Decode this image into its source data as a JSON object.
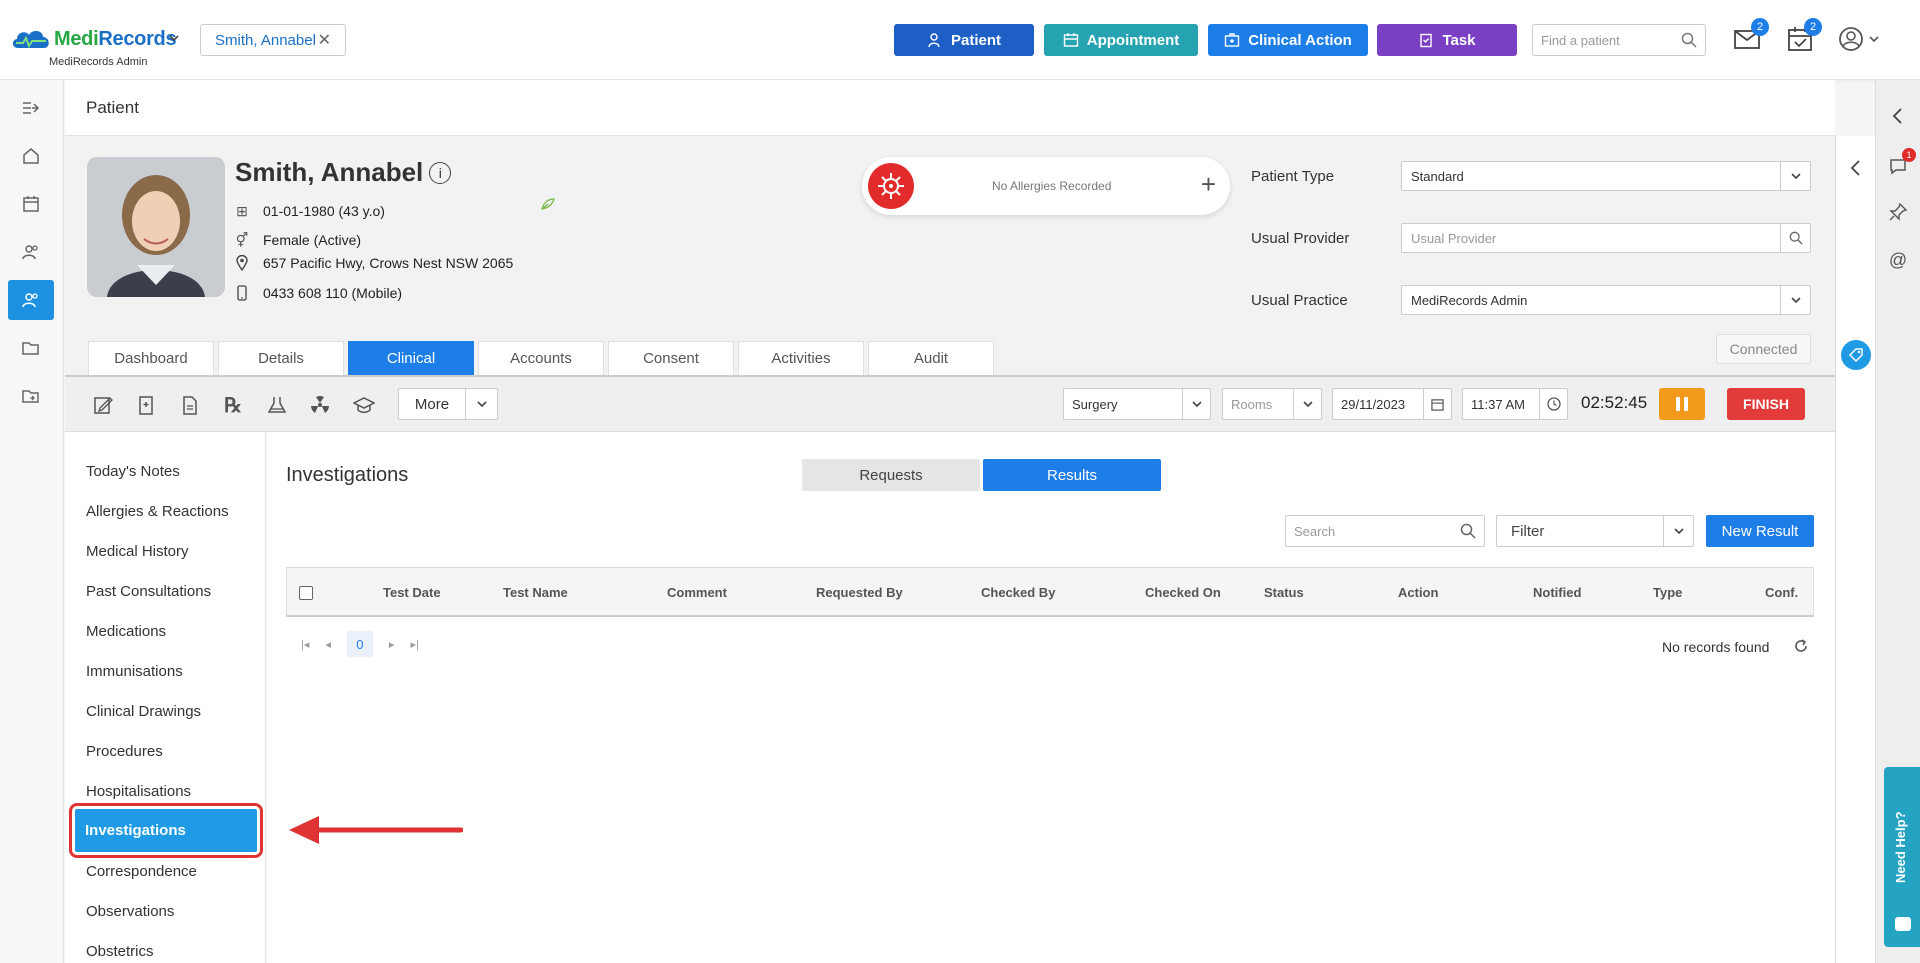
{
  "app": {
    "logo_part1": "Medi",
    "logo_part2": "Records",
    "subtitle": "MediRecords Admin"
  },
  "topbar": {
    "patient_pill": "Smith, Annabel",
    "buttons": {
      "patient": "Patient",
      "appointment": "Appointment",
      "clinical_action": "Clinical Action",
      "task": "Task"
    },
    "find_placeholder": "Find a patient",
    "mail_count": "2",
    "tasks_count": "2"
  },
  "page": {
    "title": "Patient"
  },
  "patient": {
    "name": "Smith, Annabel",
    "dob": "01-01-1980 (43 y.o)",
    "gender": "Female (Active)",
    "address": "657 Pacific Hwy, Crows Nest NSW 2065",
    "phone": "0433 608 110 (Mobile)",
    "allergies": "No Allergies Recorded",
    "fields": {
      "type_label": "Patient Type",
      "type_value": "Standard",
      "provider_label": "Usual Provider",
      "provider_placeholder": "Usual Provider",
      "practice_label": "Usual Practice",
      "practice_value": "MediRecords Admin"
    },
    "connected": "Connected"
  },
  "tabs": [
    "Dashboard",
    "Details",
    "Clinical",
    "Accounts",
    "Consent",
    "Activities",
    "Audit"
  ],
  "toolbar": {
    "more": "More",
    "location": "Surgery",
    "rooms_placeholder": "Rooms",
    "date": "29/11/2023",
    "time": "11:37 AM",
    "timer": "02:52:45",
    "finish": "FINISH"
  },
  "sidelist": [
    "Today's Notes",
    "Allergies & Reactions",
    "Medical History",
    "Past Consultations",
    "Medications",
    "Immunisations",
    "Clinical Drawings",
    "Procedures",
    "Hospitalisations",
    "Investigations",
    "Correspondence",
    "Observations",
    "Obstetrics"
  ],
  "main": {
    "title": "Investigations",
    "segments": {
      "requests": "Requests",
      "results": "Results"
    },
    "search_placeholder": "Search",
    "filter": "Filter",
    "new_result": "New Result",
    "columns": [
      "Test Date",
      "Test Name",
      "Comment",
      "Requested By",
      "Checked By",
      "Checked On",
      "Status",
      "Action",
      "Notified",
      "Type",
      "Conf."
    ],
    "page_number": "0",
    "no_records": "No records found"
  },
  "rightbar": {
    "notif_count": "1",
    "need_help": "Need Help?"
  },
  "colors": {
    "primary": "#1e7ee8",
    "patient_btn": "#1d5fc4",
    "appointment_btn": "#26a3b0",
    "task_btn": "#7b3fc4",
    "finish": "#e33a3a",
    "pause": "#f39a1d",
    "highlight": "#e03333"
  }
}
